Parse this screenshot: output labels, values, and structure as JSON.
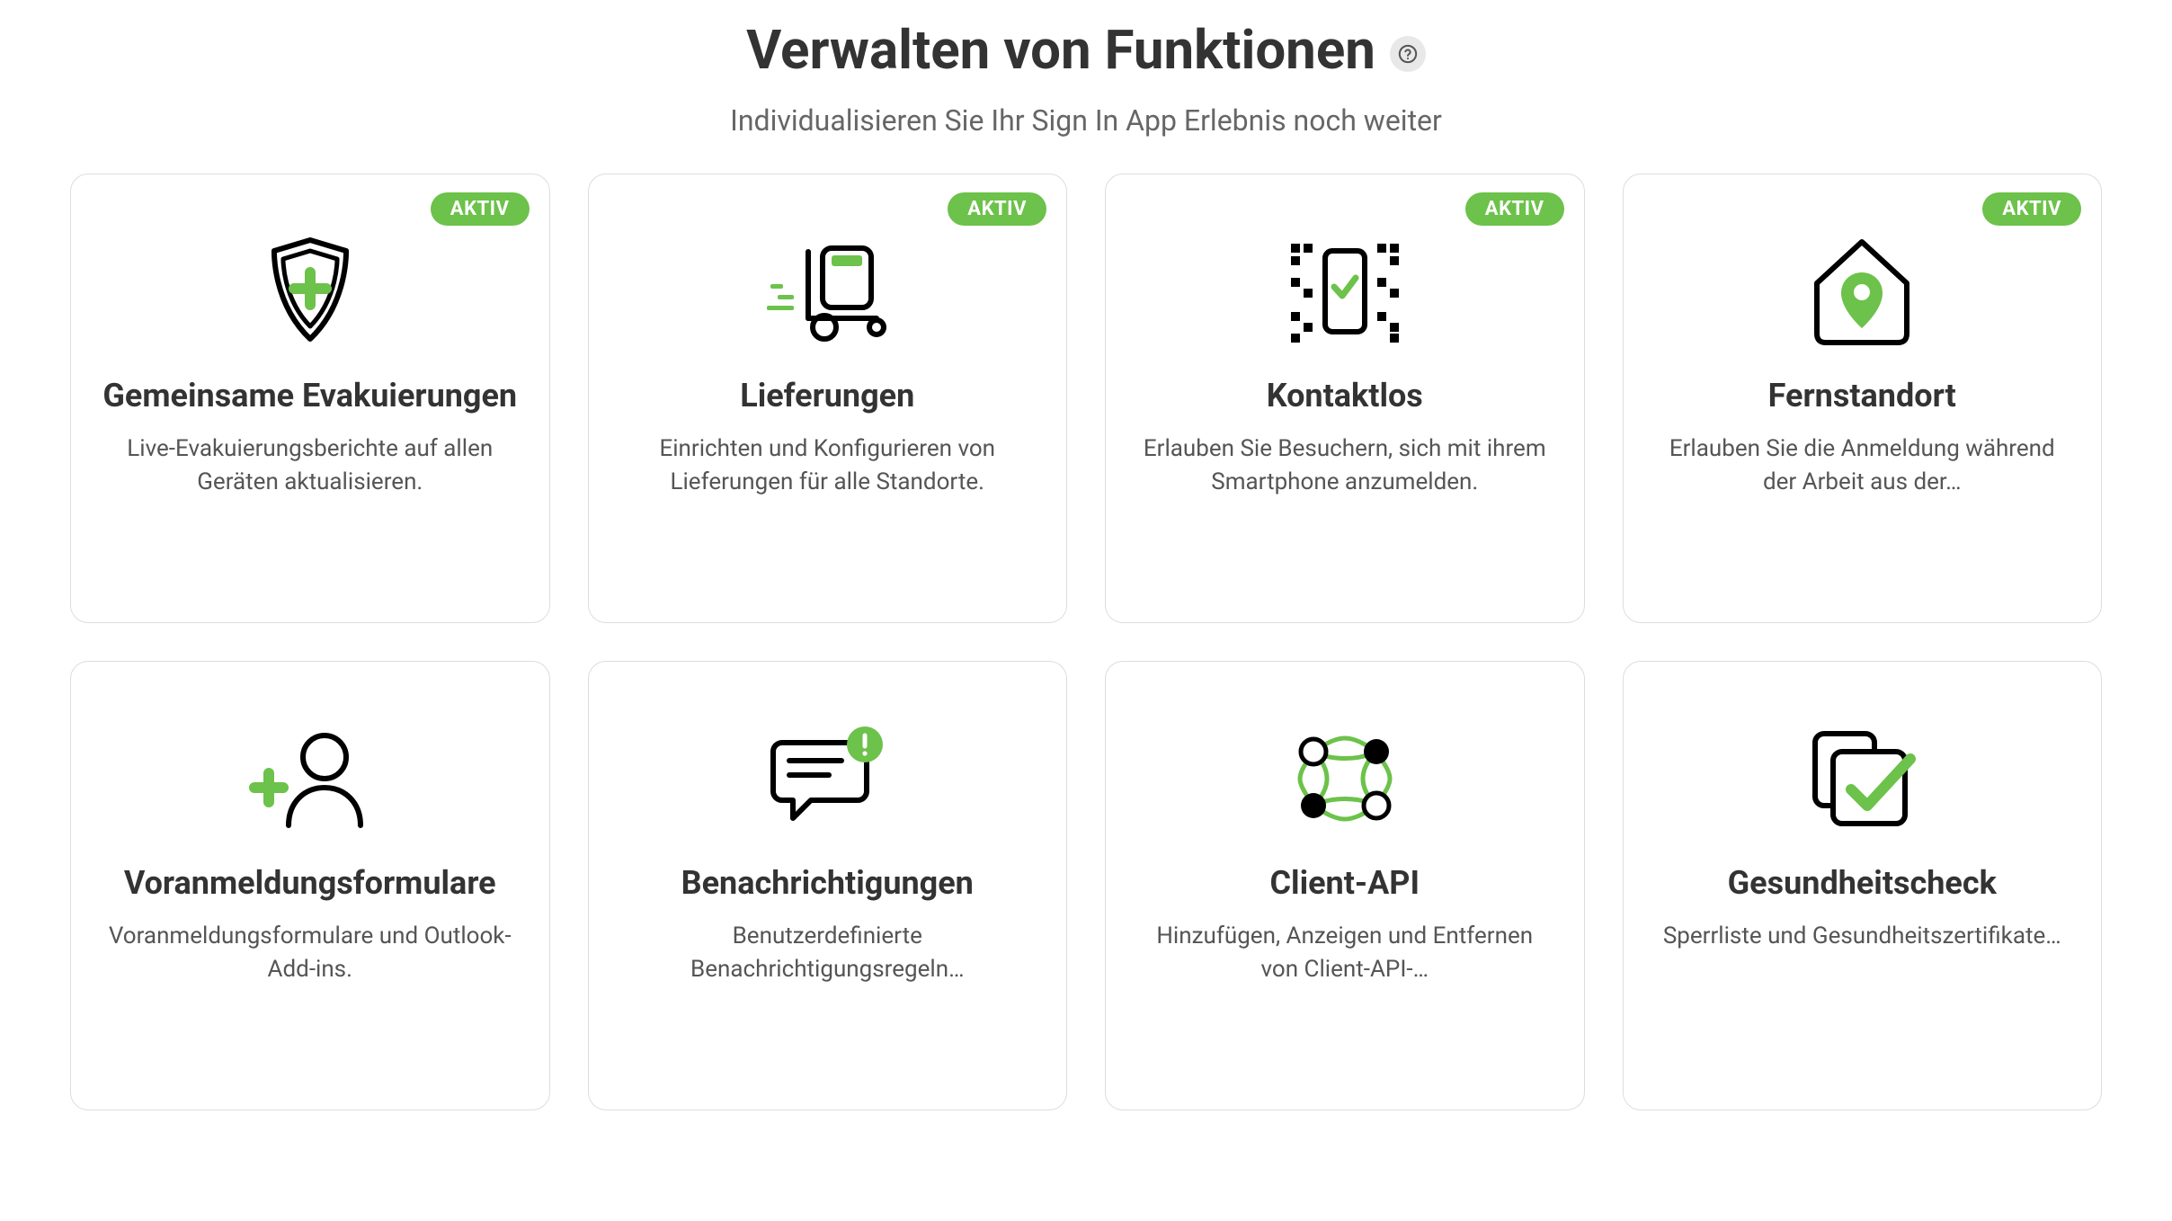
{
  "header": {
    "title": "Verwalten von Funktionen",
    "subtitle": "Individualisieren Sie Ihr Sign In App Erlebnis noch weiter"
  },
  "badge_label": "AKTIV",
  "cards": [
    {
      "id": "evacuations",
      "title": "Gemeinsame Evakuierungen",
      "desc": "Live-Evakuierungsberichte auf allen Geräten aktualisieren.",
      "active": true,
      "icon": "shield-plus"
    },
    {
      "id": "deliveries",
      "title": "Lieferungen",
      "desc": "Einrichten und Konfigurieren von Lieferungen für alle Standorte.",
      "active": true,
      "icon": "hand-truck"
    },
    {
      "id": "contactless",
      "title": "Kontaktlos",
      "desc": "Erlauben Sie Besuchern, sich mit ihrem Smartphone anzumelden.",
      "active": true,
      "icon": "qr-phone"
    },
    {
      "id": "remote-site",
      "title": "Fernstandort",
      "desc": "Erlauben Sie die Anmeldung während der Arbeit aus der…",
      "active": true,
      "icon": "house-pin"
    },
    {
      "id": "prereg-forms",
      "title": "Voranmeldungsformulare",
      "desc": "Voranmeldungsformulare und Outlook-Add-ins.",
      "active": false,
      "icon": "user-plus"
    },
    {
      "id": "notifications",
      "title": "Benachrichtigungen",
      "desc": "Benutzerdefinierte Benachrichtigungsregeln…",
      "active": false,
      "icon": "chat-alert"
    },
    {
      "id": "client-api",
      "title": "Client-API",
      "desc": "Hinzufügen, Anzeigen und Entfernen von Client-API-…",
      "active": false,
      "icon": "api-network"
    },
    {
      "id": "health-check",
      "title": "Gesundheitscheck",
      "desc": "Sperrliste und Gesundheitszertifikate…",
      "active": false,
      "icon": "clipboard-check"
    }
  ]
}
